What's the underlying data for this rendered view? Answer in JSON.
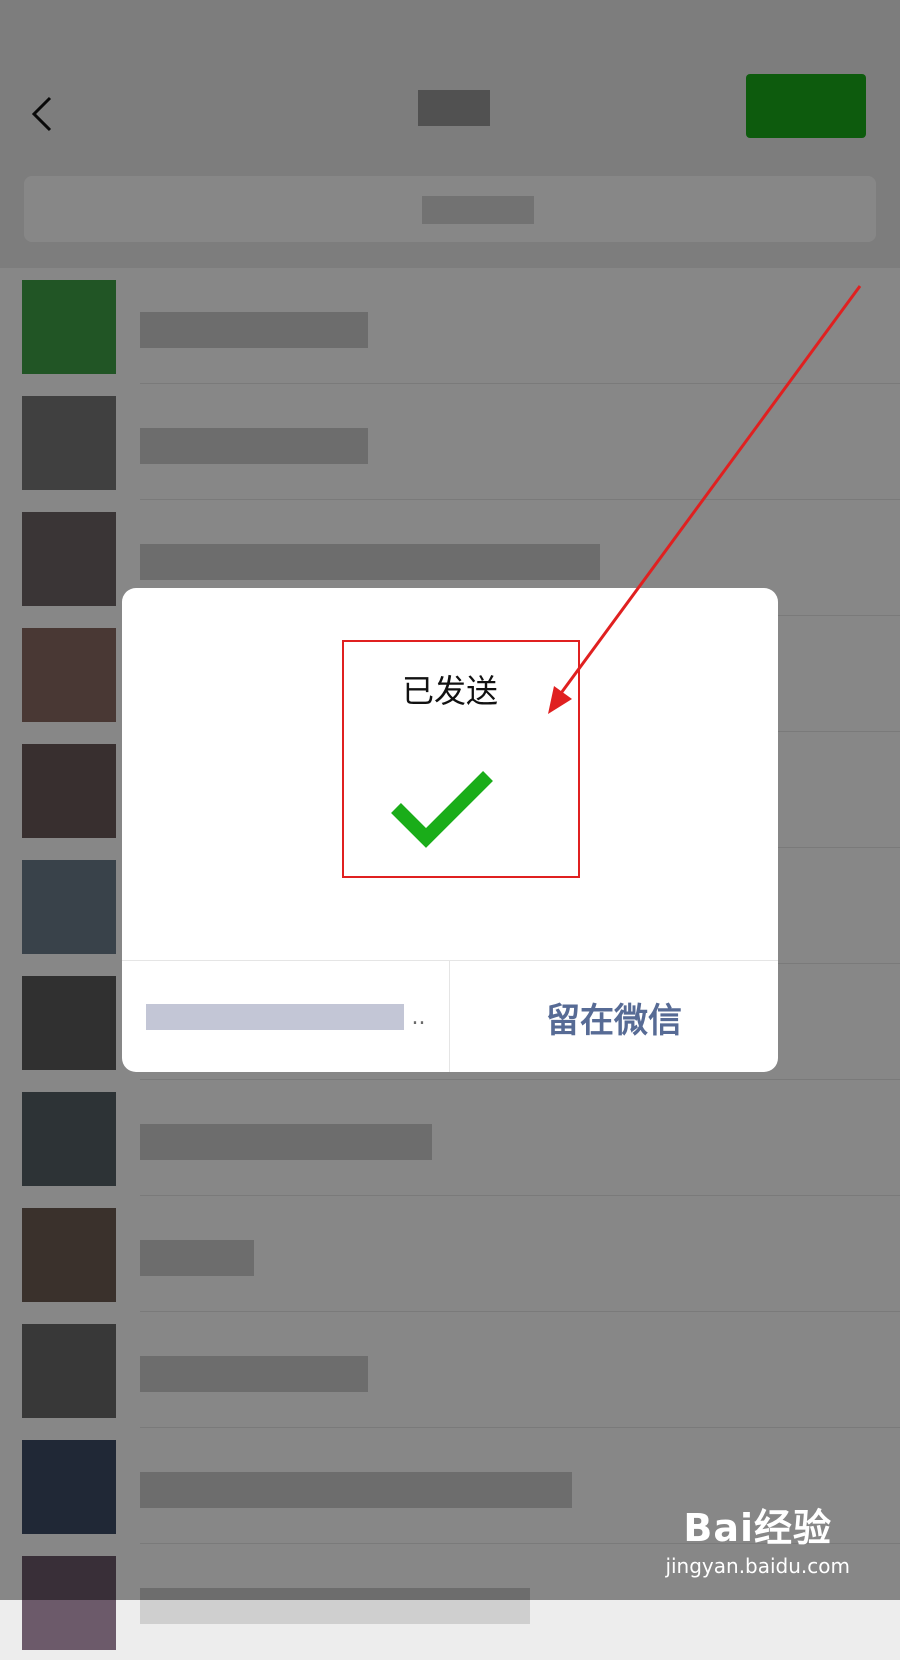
{
  "dialog": {
    "title": "已发送",
    "stay_button_label": "留在微信",
    "back_button_ellipsis": ".."
  },
  "watermark": {
    "logo": "Bai经验",
    "sub": "jingyan.baidu.com"
  },
  "colors": {
    "wechat_green": "#1aad19",
    "link_blue": "#576b95",
    "annotation_red": "#e02020"
  },
  "icons": {
    "back": "chevron-left-icon",
    "check": "check-icon"
  }
}
